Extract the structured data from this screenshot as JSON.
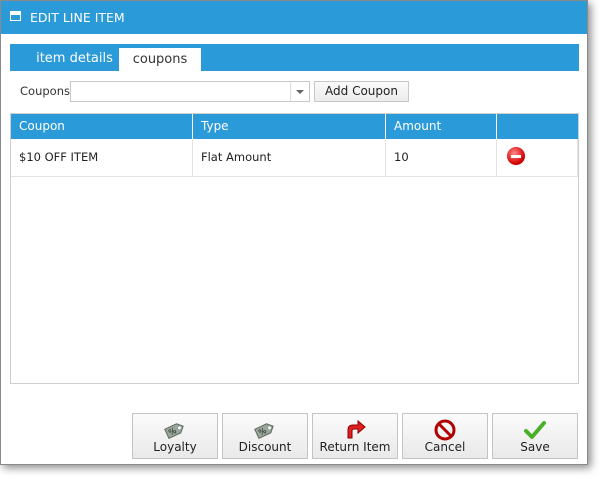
{
  "window": {
    "title": "EDIT LINE ITEM"
  },
  "tabs": [
    {
      "label": "item details",
      "active": false
    },
    {
      "label": "coupons",
      "active": true
    }
  ],
  "coupon_picker": {
    "label": "Coupons",
    "value": "",
    "button_label": "Add Coupon"
  },
  "grid": {
    "columns": [
      "Coupon",
      "Type",
      "Amount",
      ""
    ],
    "rows": [
      {
        "coupon": "$10 OFF ITEM",
        "type": "Flat Amount",
        "amount": "10",
        "action_icon": "remove-icon"
      }
    ]
  },
  "buttons": [
    {
      "label": "Loyalty",
      "icon": "loyalty-tag-icon"
    },
    {
      "label": "Discount",
      "icon": "discount-tag-icon"
    },
    {
      "label": "Return Item",
      "icon": "return-arrow-icon"
    },
    {
      "label": "Cancel",
      "icon": "cancel-icon"
    },
    {
      "label": "Save",
      "icon": "checkmark-icon"
    }
  ],
  "colors": {
    "accent": "#2a9ad8",
    "remove": "#d40000",
    "save_check": "#4caf2a",
    "cancel": "#b00000"
  }
}
